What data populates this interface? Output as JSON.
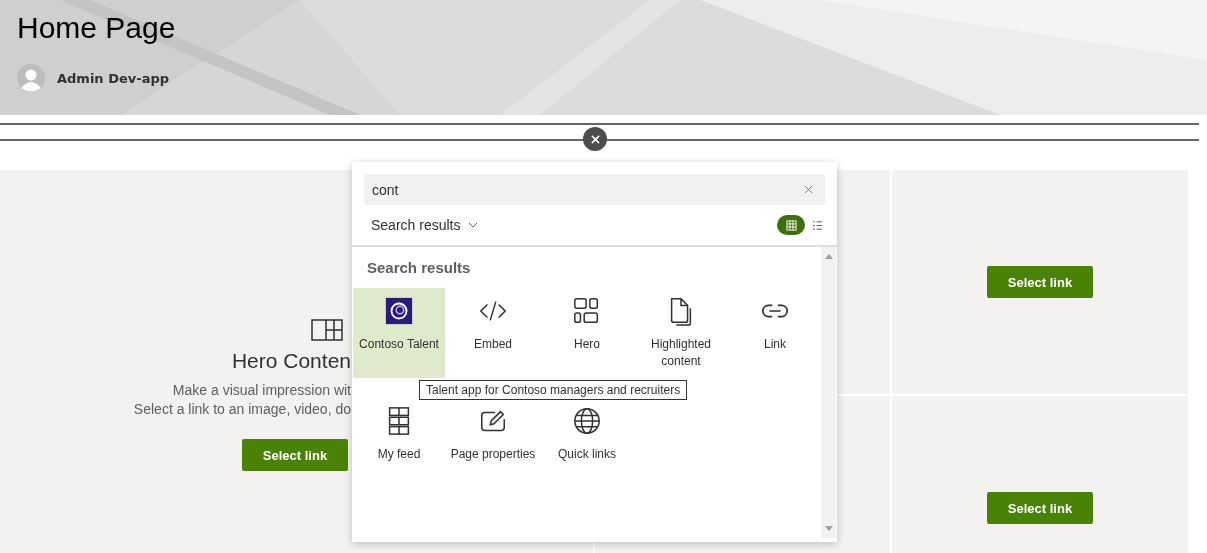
{
  "page": {
    "title": "Home Page",
    "author": "Admin Dev-app"
  },
  "hero": {
    "title": "Hero Conten",
    "lines": [
      "Make a visual impression wit",
      "Select a link to an image, video, do"
    ],
    "button": "Select link"
  },
  "tiles": [
    {
      "button": "Select link"
    },
    {
      "button": "Select link"
    }
  ],
  "picker": {
    "search": {
      "value": "cont"
    },
    "filter": "Search results",
    "views": [
      {
        "kind": "grid",
        "selected": true
      },
      {
        "kind": "list",
        "selected": false
      }
    ],
    "heading": "Search results",
    "items": [
      {
        "kind": "app",
        "label": "Contoso Talent",
        "selected": true
      },
      {
        "kind": "embed",
        "label": "Embed",
        "selected": false
      },
      {
        "kind": "hero",
        "label": "Hero",
        "selected": false
      },
      {
        "kind": "document",
        "label": "Highlighted content",
        "selected": false
      },
      {
        "kind": "link",
        "label": "Link",
        "selected": false
      },
      {
        "kind": "feed",
        "label": "My feed",
        "selected": false
      },
      {
        "kind": "page",
        "label": "Page properties",
        "selected": false
      },
      {
        "kind": "globe",
        "label": "Quick links",
        "selected": false
      }
    ],
    "tooltip": "Talent app for Contoso managers and recruiters"
  }
}
